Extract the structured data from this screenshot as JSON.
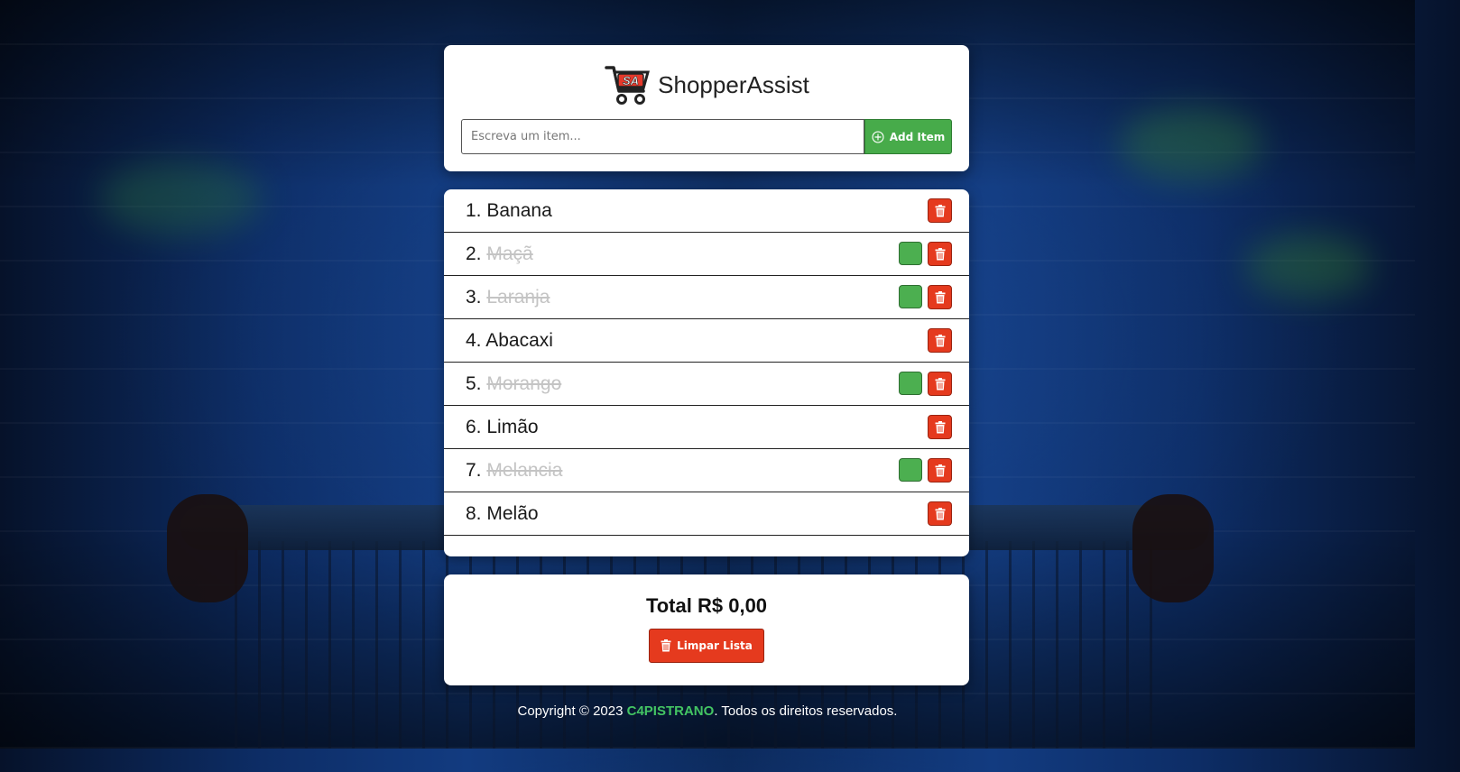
{
  "colors": {
    "accent_green": "#47ab4a",
    "danger_red": "#e53a1e",
    "card_bg": "#ffffff",
    "done_text": "#c4c4c4",
    "footer_brand": "#43c463"
  },
  "header": {
    "app_title": "ShopperAssist",
    "logo_icon": "shopping-cart-sa-logo-icon"
  },
  "add_item": {
    "placeholder": "Escreva um item...",
    "value": "",
    "button_label": "Add Item",
    "button_icon": "plus-circle-icon"
  },
  "items": [
    {
      "number": "1.",
      "name": "Banana",
      "done": false
    },
    {
      "number": "2.",
      "name": "Maçã",
      "done": true
    },
    {
      "number": "3.",
      "name": "Laranja",
      "done": true
    },
    {
      "number": "4.",
      "name": "Abacaxi",
      "done": false
    },
    {
      "number": "5.",
      "name": "Morango",
      "done": true
    },
    {
      "number": "6.",
      "name": "Limão",
      "done": false
    },
    {
      "number": "7.",
      "name": "Melancia",
      "done": true
    },
    {
      "number": "8.",
      "name": "Melão",
      "done": false
    }
  ],
  "summary": {
    "total_label": "Total",
    "total_value": "R$ 0,00",
    "clear_label": "Limpar Lista",
    "clear_icon": "trash-icon"
  },
  "footer": {
    "prefix": "Copyright © 2023 ",
    "brand": "C4PISTRANO",
    "suffix": ". Todos os direitos reservados."
  }
}
